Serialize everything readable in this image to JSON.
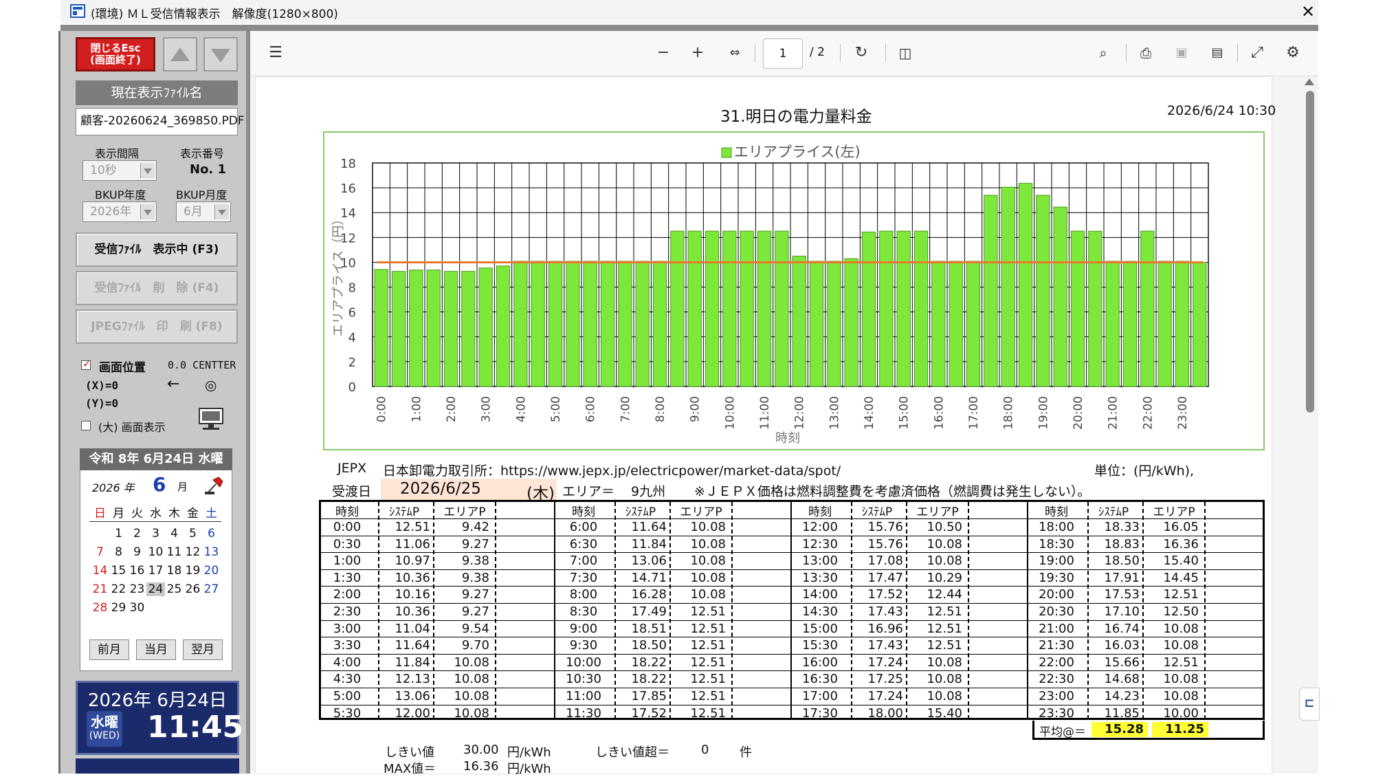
{
  "window": {
    "title": "(環境) ＭＬ受信情報表示　解像度(1280×800)"
  },
  "left": {
    "close_button": "閉じるEsc\n(画面終了)",
    "current_file_header": "現在表示ﾌｧｲﾙ名",
    "current_file": "顧客-20260624_369850.PDF",
    "interval_label": "表示間隔",
    "interval_value": "10秒",
    "display_no_label": "表示番号",
    "display_no_value": "No. 1",
    "bkup_year_label": "BKUP年度",
    "bkup_year_value": "2026年",
    "bkup_month_label": "BKUP月度",
    "bkup_month_value": "6月",
    "btn_receive": "受信ﾌｧｲﾙ　表示中 (F3)",
    "btn_delete": "受信ﾌｧｲﾙ　削　除 (F4)",
    "btn_print": "JPEGﾌｧｲﾙ　印　刷 (F8)",
    "screen_pos_label": "画面位置",
    "screen_pos_value": "0.0 CENTTER",
    "x_label": "(X)=0",
    "y_label": "(Y)=0",
    "arrow_glyph": "←",
    "target_glyph": "◎",
    "big_screen_label": "(大) 画面表示"
  },
  "calendar": {
    "header": "令和 8年 6月24日 水曜",
    "year": "2026 年",
    "month": "6",
    "month_suffix": "月",
    "weekdays": [
      "日",
      "月",
      "火",
      "水",
      "木",
      "金",
      "土"
    ],
    "weeks": [
      [
        "",
        "1",
        "2",
        "3",
        "4",
        "5",
        "6"
      ],
      [
        "7",
        "8",
        "9",
        "10",
        "11",
        "12",
        "13"
      ],
      [
        "14",
        "15",
        "16",
        "17",
        "18",
        "19",
        "20"
      ],
      [
        "21",
        "22",
        "23",
        "24",
        "25",
        "26",
        "27"
      ],
      [
        "28",
        "29",
        "30",
        "",
        "",
        "",
        ""
      ]
    ],
    "today": "24",
    "btn_prev": "前月",
    "btn_current": "当月",
    "btn_next": "翌月"
  },
  "clock": {
    "date": "2026年 6月24日",
    "weekday": "水曜",
    "weekday_en": "(WED)",
    "time": "11:45"
  },
  "viewer": {
    "page_current": "1",
    "page_total": "/ 2"
  },
  "doc": {
    "title": "31.明日の電力量料金",
    "datetime": "2026/6/24  10:30",
    "jepx_label": "JEPX",
    "jepx_text": "日本卸電力取引所：https://www.jepx.jp/electricpower/market-data/spot/",
    "unit": "単位：(円/kWh),",
    "delivery_label": "受渡日",
    "delivery_date": "2026/6/25",
    "delivery_dow": "(木)",
    "area_label": "エリア＝",
    "area_value": "9九州",
    "note": "※ＪＥＰＸ価格は燃料調整費を考慮済価格（燃調費は発生しない）。",
    "threshold_label": "しきい値",
    "threshold_value": "30.00",
    "threshold_unit": "円/kWh",
    "exceed_label": "しきい値超＝",
    "exceed_value": "0",
    "exceed_unit": "件",
    "max_label": "MAX値＝",
    "max_value": "16.36",
    "max_unit": "円/kWh",
    "avg_label": "平均@＝",
    "avg_system": "15.28",
    "avg_area": "11.25",
    "col_time": "時刻",
    "col_system": "ｼｽﾃﾑP",
    "col_area": "エリアP"
  },
  "table_rows": [
    [
      "0:00",
      "12.51",
      "9.42"
    ],
    [
      "0:30",
      "11.06",
      "9.27"
    ],
    [
      "1:00",
      "10.97",
      "9.38"
    ],
    [
      "1:30",
      "10.36",
      "9.38"
    ],
    [
      "2:00",
      "10.16",
      "9.27"
    ],
    [
      "2:30",
      "10.36",
      "9.27"
    ],
    [
      "3:00",
      "11.04",
      "9.54"
    ],
    [
      "3:30",
      "11.64",
      "9.70"
    ],
    [
      "4:00",
      "11.84",
      "10.08"
    ],
    [
      "4:30",
      "12.13",
      "10.08"
    ],
    [
      "5:00",
      "13.06",
      "10.08"
    ],
    [
      "5:30",
      "12.00",
      "10.08"
    ],
    [
      "6:00",
      "11.64",
      "10.08"
    ],
    [
      "6:30",
      "11.84",
      "10.08"
    ],
    [
      "7:00",
      "13.06",
      "10.08"
    ],
    [
      "7:30",
      "14.71",
      "10.08"
    ],
    [
      "8:00",
      "16.28",
      "10.08"
    ],
    [
      "8:30",
      "17.49",
      "12.51"
    ],
    [
      "9:00",
      "18.51",
      "12.51"
    ],
    [
      "9:30",
      "18.50",
      "12.51"
    ],
    [
      "10:00",
      "18.22",
      "12.51"
    ],
    [
      "10:30",
      "18.22",
      "12.51"
    ],
    [
      "11:00",
      "17.85",
      "12.51"
    ],
    [
      "11:30",
      "17.52",
      "12.51"
    ],
    [
      "12:00",
      "15.76",
      "10.50"
    ],
    [
      "12:30",
      "15.76",
      "10.08"
    ],
    [
      "13:00",
      "17.08",
      "10.08"
    ],
    [
      "13:30",
      "17.47",
      "10.29"
    ],
    [
      "14:00",
      "17.52",
      "12.44"
    ],
    [
      "14:30",
      "17.43",
      "12.51"
    ],
    [
      "15:00",
      "16.96",
      "12.51"
    ],
    [
      "15:30",
      "17.43",
      "12.51"
    ],
    [
      "16:00",
      "17.24",
      "10.08"
    ],
    [
      "16:30",
      "17.25",
      "10.08"
    ],
    [
      "17:00",
      "17.24",
      "10.08"
    ],
    [
      "17:30",
      "18.00",
      "15.40"
    ],
    [
      "18:00",
      "18.33",
      "16.05"
    ],
    [
      "18:30",
      "18.83",
      "16.36"
    ],
    [
      "19:00",
      "18.50",
      "15.40"
    ],
    [
      "19:30",
      "17.91",
      "14.45"
    ],
    [
      "20:00",
      "17.53",
      "12.51"
    ],
    [
      "20:30",
      "17.10",
      "12.50"
    ],
    [
      "21:00",
      "16.74",
      "10.08"
    ],
    [
      "21:30",
      "16.03",
      "10.08"
    ],
    [
      "22:00",
      "15.66",
      "12.51"
    ],
    [
      "22:30",
      "14.68",
      "10.08"
    ],
    [
      "23:00",
      "14.23",
      "10.08"
    ],
    [
      "23:30",
      "11.85",
      "10.00"
    ]
  ],
  "chart_data": {
    "type": "bar",
    "legend": "エリアプライス(左)",
    "legend_position": "top",
    "xlabel": "時刻",
    "ylabel": "エリアプライス（円）",
    "ylim": [
      0,
      18
    ],
    "yticks": [
      0,
      2,
      4,
      6,
      8,
      10,
      12,
      14,
      16,
      18
    ],
    "x_tick_labels": [
      "0:00",
      "1:00",
      "2:00",
      "3:00",
      "4:00",
      "5:00",
      "6:00",
      "7:00",
      "8:00",
      "9:00",
      "10:00",
      "11:00",
      "12:00",
      "13:00",
      "14:00",
      "15:00",
      "16:00",
      "17:00",
      "18:00",
      "19:00",
      "20:00",
      "21:00",
      "22:00",
      "23:00"
    ],
    "categories": [
      "0:00",
      "0:30",
      "1:00",
      "1:30",
      "2:00",
      "2:30",
      "3:00",
      "3:30",
      "4:00",
      "4:30",
      "5:00",
      "5:30",
      "6:00",
      "6:30",
      "7:00",
      "7:30",
      "8:00",
      "8:30",
      "9:00",
      "9:30",
      "10:00",
      "10:30",
      "11:00",
      "11:30",
      "12:00",
      "12:30",
      "13:00",
      "13:30",
      "14:00",
      "14:30",
      "15:00",
      "15:30",
      "16:00",
      "16:30",
      "17:00",
      "17:30",
      "18:00",
      "18:30",
      "19:00",
      "19:30",
      "20:00",
      "20:30",
      "21:00",
      "21:30",
      "22:00",
      "22:30",
      "23:00",
      "23:30"
    ],
    "series": [
      {
        "name": "エリアプライス(左)",
        "values": [
          9.42,
          9.27,
          9.38,
          9.38,
          9.27,
          9.27,
          9.54,
          9.7,
          10.08,
          10.08,
          10.08,
          10.08,
          10.08,
          10.08,
          10.08,
          10.08,
          10.08,
          12.51,
          12.51,
          12.51,
          12.51,
          12.51,
          12.51,
          12.51,
          10.5,
          10.08,
          10.08,
          10.29,
          12.44,
          12.51,
          12.51,
          12.51,
          10.08,
          10.08,
          10.08,
          15.4,
          16.05,
          16.36,
          15.4,
          14.45,
          12.51,
          12.5,
          10.08,
          10.08,
          12.51,
          10.08,
          10.08,
          10.0
        ]
      }
    ],
    "reference_line": 10,
    "grid": true,
    "colors": {
      "bar": "#7ee83a",
      "bar_edge": "#4a9a22",
      "reference": "#e87a2a"
    }
  }
}
